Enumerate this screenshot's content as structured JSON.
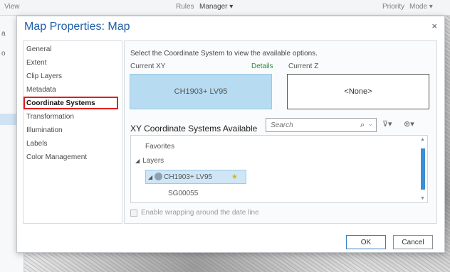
{
  "app": {
    "menu_view": "View",
    "menu_rules": "Rules",
    "menu_manager": "Manager ▾",
    "menu_priority": "Priority",
    "menu_mode": "Mode ▾",
    "left_stub_a": "a",
    "left_stub_b": "o"
  },
  "dialog": {
    "title": "Map Properties: Map",
    "close_glyph": "×"
  },
  "nav": {
    "items": [
      {
        "label": "General"
      },
      {
        "label": "Extent"
      },
      {
        "label": "Clip Layers"
      },
      {
        "label": "Metadata"
      },
      {
        "label": "Coordinate Systems",
        "active": true
      },
      {
        "label": "Transformation"
      },
      {
        "label": "Illumination"
      },
      {
        "label": "Labels"
      },
      {
        "label": "Color Management"
      }
    ]
  },
  "coord": {
    "hint": "Select the Coordinate System to view the available options.",
    "current_xy_label": "Current XY",
    "details_link": "Details",
    "current_z_label": "Current Z",
    "current_xy_value": "CH1903+ LV95",
    "current_z_value": "<None>",
    "available_title": "XY Coordinate Systems Available",
    "search_placeholder": "Search",
    "tree": {
      "favorites": "Favorites",
      "layers": "Layers",
      "selected": "CH1903+ LV95",
      "child": "SG00055"
    },
    "wrap_label": "Enable wrapping around the date line"
  },
  "footer": {
    "ok": "OK",
    "cancel": "Cancel"
  },
  "colors": {
    "accent": "#1f5fa8",
    "highlight_box": "#e02020",
    "selected_fill": "#b7dbf1",
    "details_link": "#2f8a3f"
  }
}
